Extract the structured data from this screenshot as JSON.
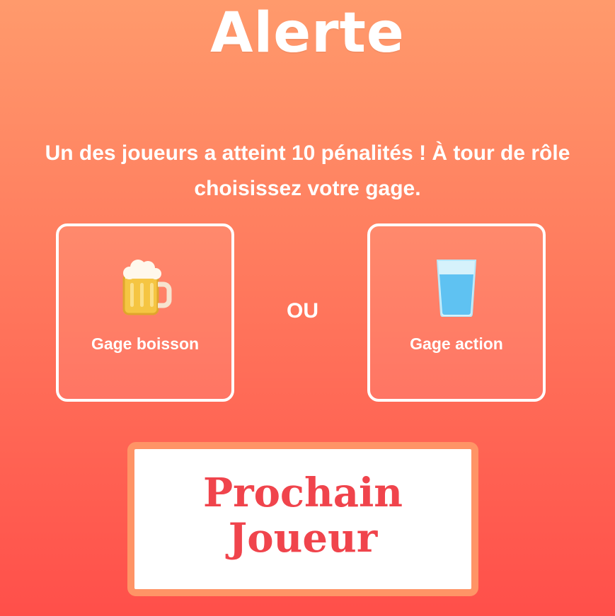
{
  "header": {
    "title": "Alerte"
  },
  "message": {
    "line1": "Un des joueurs a atteint 10 pénalités ! À tour de rôle",
    "line2": "choisissez votre gage."
  },
  "choices": {
    "drink": {
      "label": "Gage boisson",
      "icon": "beer-mug-icon"
    },
    "separator": "OU",
    "action": {
      "label": "Gage action",
      "icon": "water-glass-icon"
    }
  },
  "next_button": {
    "line1": "Prochain",
    "line2": "Joueur"
  },
  "colors": {
    "background_top": "#ff9a6c",
    "background_bottom": "#ff4f4a",
    "button_text": "#f0444c",
    "button_border": "#ff9466"
  }
}
